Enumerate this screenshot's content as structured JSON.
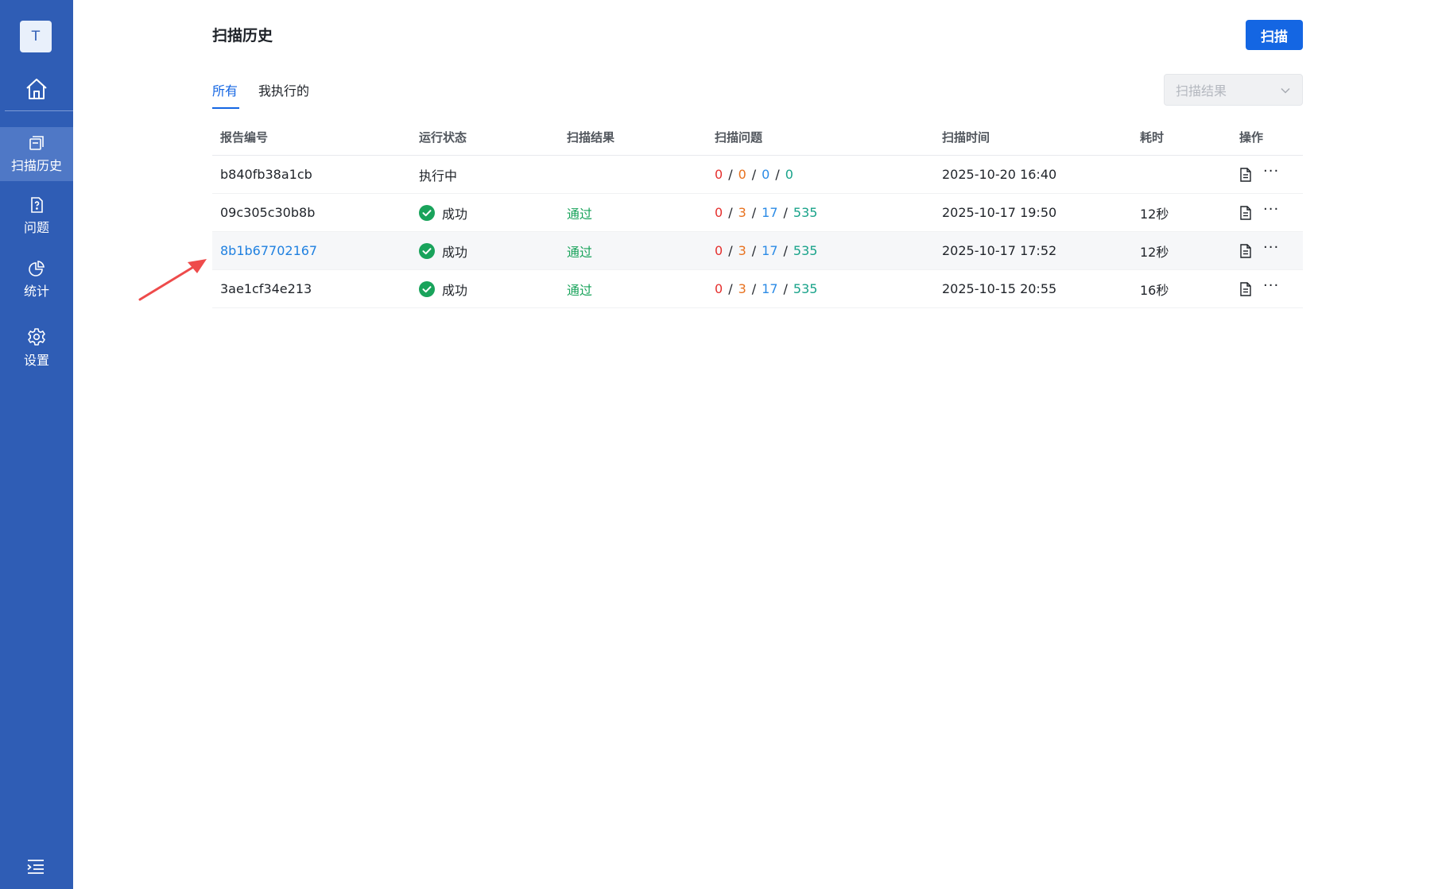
{
  "sidebar": {
    "avatar_initial": "T",
    "items": [
      {
        "label": "扫描历史",
        "icon": "history-icon",
        "active": true
      },
      {
        "label": "问题",
        "icon": "question-doc-icon",
        "active": false
      },
      {
        "label": "统计",
        "icon": "pie-chart-icon",
        "active": false
      },
      {
        "label": "设置",
        "icon": "gear-icon",
        "active": false
      }
    ]
  },
  "header": {
    "title": "扫描历史",
    "scan_button": "扫描"
  },
  "tabs": [
    {
      "label": "所有",
      "active": true
    },
    {
      "label": "我执行的",
      "active": false
    }
  ],
  "filter": {
    "placeholder": "扫描结果"
  },
  "table": {
    "columns": [
      "报告编号",
      "运行状态",
      "扫描结果",
      "扫描问题",
      "扫描时间",
      "耗时",
      "操作"
    ],
    "issue_separator": "/",
    "more_label": "···",
    "rows": [
      {
        "id": "b840fb38a1cb",
        "status": "执行中",
        "result": "",
        "issues": [
          "0",
          "0",
          "0",
          "0"
        ],
        "time": "2025-10-20 16:40",
        "duration": ""
      },
      {
        "id": "09c305c30b8b",
        "status": "成功",
        "result": "通过",
        "issues": [
          "0",
          "3",
          "17",
          "535"
        ],
        "time": "2025-10-17 19:50",
        "duration": "12秒"
      },
      {
        "id": "8b1b67702167",
        "status": "成功",
        "result": "通过",
        "issues": [
          "0",
          "3",
          "17",
          "535"
        ],
        "time": "2025-10-17 17:52",
        "duration": "12秒"
      },
      {
        "id": "3ae1cf34e213",
        "status": "成功",
        "result": "通过",
        "issues": [
          "0",
          "3",
          "17",
          "535"
        ],
        "time": "2025-10-15 20:55",
        "duration": "16秒"
      }
    ]
  },
  "colors": {
    "sidebar_bg": "#2f5db5",
    "primary": "#1466e3",
    "success": "#19a35b",
    "issue_critical": "#e5312f",
    "issue_major": "#e8721f",
    "issue_minor": "#2b8be6",
    "issue_info": "#19a38a",
    "annotation_arrow": "#ee4b4b"
  }
}
